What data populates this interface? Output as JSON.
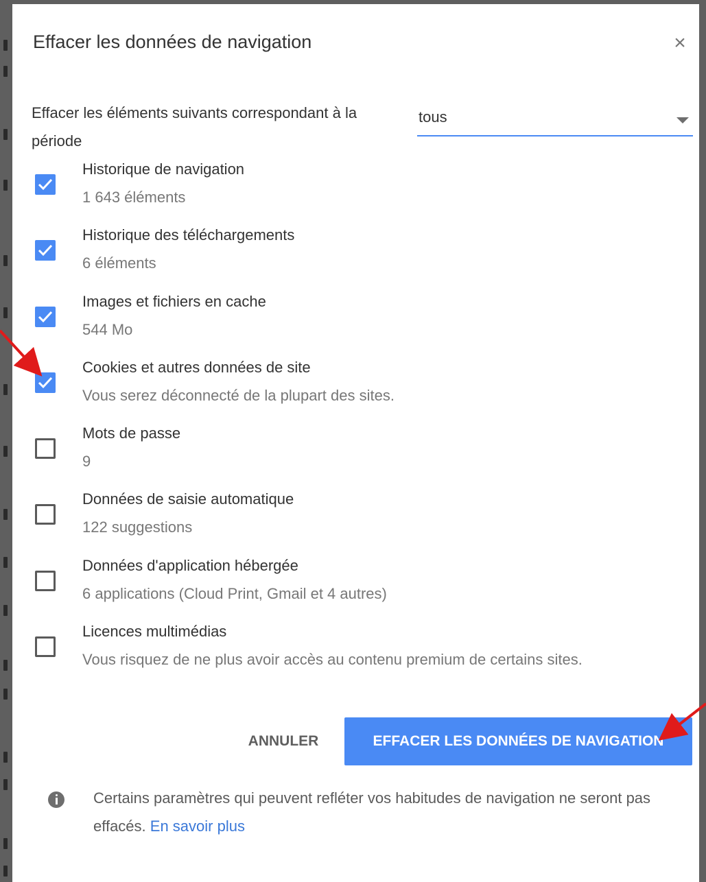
{
  "dialog": {
    "title": "Effacer les données de navigation",
    "close_glyph": "×"
  },
  "period": {
    "label": "Effacer les éléments suivants correspondant à la période",
    "selected": "tous"
  },
  "options": [
    {
      "title": "Historique de navigation",
      "subtitle": "1 643 éléments",
      "checked": true
    },
    {
      "title": "Historique des téléchargements",
      "subtitle": "6 éléments",
      "checked": true
    },
    {
      "title": "Images et fichiers en cache",
      "subtitle": "544 Mo",
      "checked": true
    },
    {
      "title": "Cookies et autres données de site",
      "subtitle": "Vous serez déconnecté de la plupart des sites.",
      "checked": true
    },
    {
      "title": "Mots de passe",
      "subtitle": "9",
      "checked": false
    },
    {
      "title": "Données de saisie automatique",
      "subtitle": "122 suggestions",
      "checked": false
    },
    {
      "title": "Données d'application hébergée",
      "subtitle": "6 applications (Cloud Print, Gmail et 4 autres)",
      "checked": false
    },
    {
      "title": "Licences multimédias",
      "subtitle": "Vous risquez de ne plus avoir accès au contenu premium de certains sites.",
      "checked": false
    }
  ],
  "actions": {
    "cancel_label": "ANNULER",
    "clear_label": "EFFACER LES DONNÉES DE NAVIGATION"
  },
  "footer": {
    "text": "Certains paramètres qui peuvent refléter vos habitudes de navigation ne seront pas effacés.",
    "link_label": "En savoir plus"
  },
  "colors": {
    "accent": "#4a8af4",
    "annotation_arrow": "#e01b1b"
  },
  "icons": {
    "close": "close-icon",
    "dropdown": "triangle-down-icon",
    "check": "checkmark-icon",
    "info": "info-icon"
  }
}
